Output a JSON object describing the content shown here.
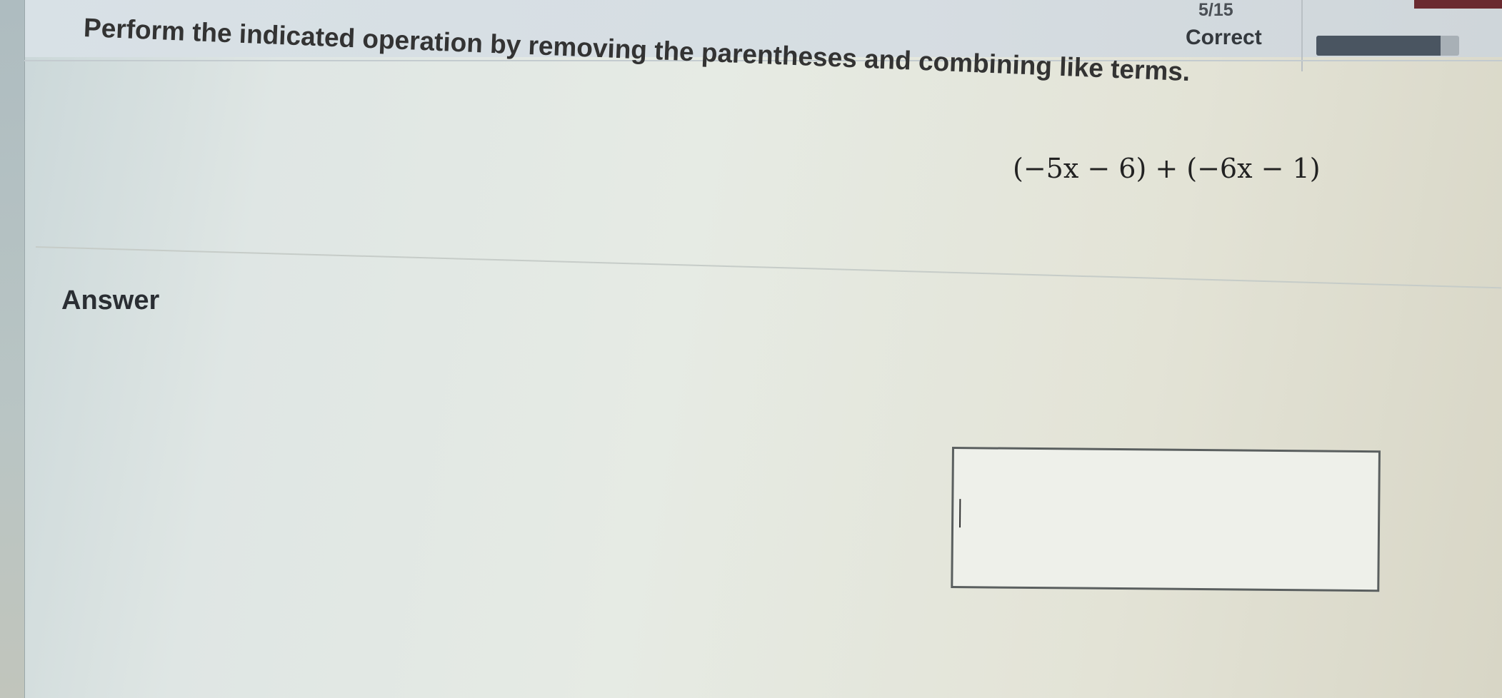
{
  "header": {
    "progress_count": "5/15",
    "status": "Correct",
    "progress_fraction": 0.87
  },
  "question": {
    "instruction": "Perform the indicated operation by removing the parentheses and combining like terms.",
    "expression": "(−5x − 6) + (−6x − 1)"
  },
  "answer": {
    "label": "Answer",
    "input_value": ""
  },
  "colors": {
    "progress_fill": "#4a5561",
    "progress_track": "#a8b0b6"
  }
}
